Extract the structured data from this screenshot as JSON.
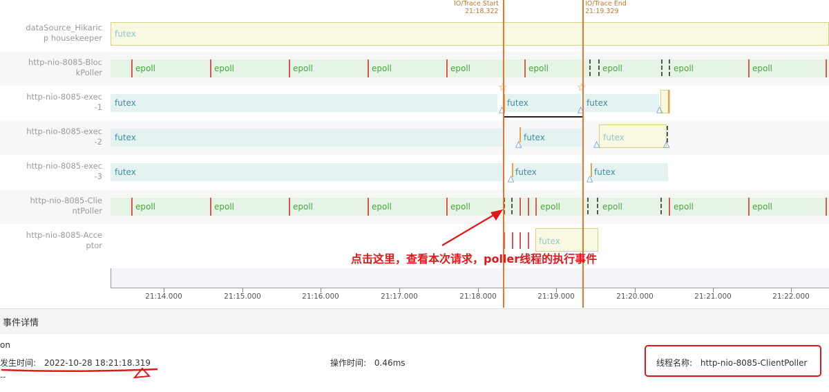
{
  "lanes": [
    {
      "name": "dataSource_Hikaric\np housekeeper"
    },
    {
      "name": "http-nio-8085-Bloc\nkPoller"
    },
    {
      "name": "http-nio-8085-exec\n-1"
    },
    {
      "name": "http-nio-8085-exec\n-2"
    },
    {
      "name": "http-nio-8085-exec\n-3"
    },
    {
      "name": "http-nio-8085-Clie\nntPoller"
    },
    {
      "name": "http-nio-8085-Acce\nptor"
    }
  ],
  "segments": {
    "futex": "futex",
    "epoll": "epoll"
  },
  "trace": {
    "start_label": "IO/Trace Start",
    "start_time": "21:18.322",
    "end_label": "IO/Trace End",
    "end_time": "21:19.329"
  },
  "axis": {
    "ticks": [
      "21:14.000",
      "21:15.000",
      "21:16.000",
      "21:17.000",
      "21:18.000",
      "21:19.000",
      "21:20.000",
      "21:21.000",
      "21:22.000"
    ]
  },
  "annotation": {
    "text": "点击这里，查看本次请求，poller线程的执行事件"
  },
  "details": {
    "header": "事件详情",
    "event_name": "on",
    "occur_time_label": "发生时间:",
    "occur_time_value": "2022-10-28 18:21:18.319",
    "op_time_label": "操作时间:",
    "op_time_value": "0.46ms",
    "thread_label": "线程名称:",
    "thread_value": "http-nio-8085-ClientPoller",
    "placeholder": "--"
  },
  "colors": {
    "trace_line": "#e8732a",
    "annotation": "#e01818",
    "futex_bar": "#e4f2f2",
    "epoll_bar": "#e6f4e6"
  }
}
